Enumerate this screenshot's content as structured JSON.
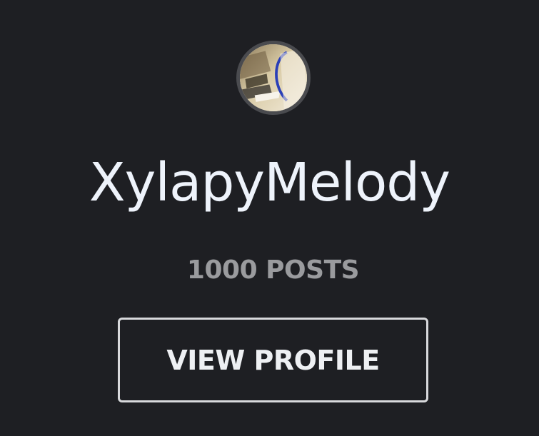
{
  "profile": {
    "username": "XylapyMelody",
    "post_count": "1000 POSTS",
    "view_profile_label": "VIEW PROFILE",
    "avatar_icon": "user-avatar-photo"
  },
  "colors": {
    "background": "#1e1f23",
    "username_text": "#eef3fb",
    "post_count_text": "#9a9b9e",
    "button_border": "#d8d9dc",
    "button_text": "#eef0f3",
    "avatar_ring": "#4a4b4f"
  }
}
